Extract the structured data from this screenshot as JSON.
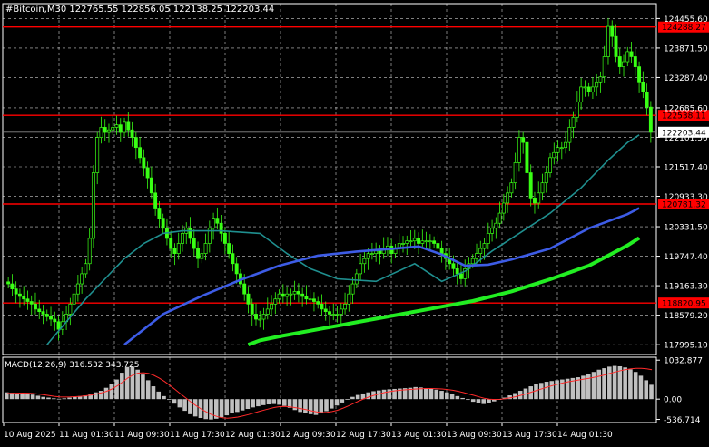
{
  "header": {
    "symbol": "#Bitcoin,M30",
    "ohlc": "122765.55 122856.05 122138.25 122203.44"
  },
  "macd": {
    "label": "MACD(12,26,9) 316.532 343.725",
    "ticks": [
      {
        "label": "1032.877",
        "v": 1032.877
      },
      {
        "label": "0.00",
        "v": 0
      },
      {
        "label": "-536.714",
        "v": -536.714
      }
    ],
    "range": [
      -620,
      1110
    ],
    "histogram": [
      180,
      170,
      160,
      150,
      140,
      120,
      90,
      60,
      40,
      20,
      10,
      20,
      40,
      60,
      80,
      100,
      140,
      180,
      220,
      300,
      400,
      520,
      700,
      850,
      860,
      780,
      650,
      500,
      340,
      200,
      80,
      -20,
      -120,
      -220,
      -310,
      -400,
      -460,
      -500,
      -530,
      -540,
      -520,
      -480,
      -430,
      -380,
      -340,
      -300,
      -260,
      -220,
      -190,
      -160,
      -140,
      -130,
      -150,
      -180,
      -230,
      -290,
      -340,
      -370,
      -400,
      -420,
      -380,
      -320,
      -250,
      -170,
      -90,
      -10,
      60,
      110,
      150,
      180,
      210,
      230,
      250,
      260,
      270,
      280,
      290,
      300,
      320,
      310,
      290,
      270,
      250,
      220,
      180,
      130,
      80,
      30,
      -20,
      -70,
      -110,
      -130,
      -100,
      -60,
      -10,
      40,
      100,
      160,
      220,
      280,
      340,
      400,
      430,
      460,
      480,
      500,
      520,
      540,
      560,
      580,
      620,
      660,
      720,
      780,
      820,
      860,
      880,
      870,
      840,
      790,
      720,
      620,
      500,
      380
    ],
    "signal": [
      150,
      155,
      158,
      160,
      158,
      150,
      135,
      115,
      95,
      75,
      60,
      55,
      58,
      65,
      75,
      90,
      110,
      135,
      165,
      210,
      270,
      350,
      450,
      560,
      640,
      690,
      700,
      680,
      630,
      560,
      470,
      370,
      260,
      150,
      40,
      -70,
      -170,
      -260,
      -340,
      -410,
      -460,
      -495,
      -505,
      -495,
      -475,
      -445,
      -410,
      -370,
      -330,
      -290,
      -255,
      -220,
      -200,
      -195,
      -205,
      -225,
      -250,
      -280,
      -310,
      -340,
      -355,
      -350,
      -330,
      -295,
      -245,
      -185,
      -120,
      -55,
      5,
      55,
      100,
      140,
      175,
      200,
      220,
      235,
      248,
      258,
      268,
      276,
      280,
      280,
      276,
      268,
      255,
      235,
      208,
      175,
      138,
      100,
      60,
      25,
      0,
      -10,
      -5,
      10,
      35,
      65,
      100,
      140,
      185,
      230,
      275,
      318,
      358,
      395,
      428,
      458,
      484,
      508,
      530,
      552,
      578,
      608,
      642,
      680,
      718,
      754,
      784,
      806,
      818,
      818,
      806,
      782
    ]
  },
  "chart_data": {
    "type": "candlestick",
    "series_name": "#Bitcoin,M30",
    "ylim": [
      117800,
      124750
    ],
    "y_ticks": [
      124455.6,
      123871.5,
      123287.4,
      122685.6,
      122101.5,
      121517.4,
      120933.3,
      120331.5,
      119747.4,
      119163.3,
      118579.2,
      117995.1
    ],
    "x_ticks": [
      "10 Aug 2025",
      "11 Aug 01:30",
      "11 Aug 09:30",
      "11 Aug 17:30",
      "12 Aug 01:30",
      "12 Aug 09:30",
      "12 Aug 17:30",
      "13 Aug 01:30",
      "13 Aug 09:30",
      "13 Aug 17:30",
      "14 Aug 01:30"
    ],
    "level_lines": [
      {
        "label": "124288.27",
        "value": 124288.27,
        "color": "#ff0000"
      },
      {
        "label": "122538.11",
        "value": 122538.11,
        "color": "#ff0000"
      },
      {
        "label": "120781.32",
        "value": 120781.32,
        "color": "#ff0000"
      },
      {
        "label": "118820.95",
        "value": 118820.95,
        "color": "#ff0000"
      }
    ],
    "current_price": {
      "label": "122203.44",
      "value": 122203.44
    },
    "close": [
      119200,
      119100,
      119000,
      118950,
      118900,
      118850,
      118800,
      118700,
      118650,
      118600,
      118550,
      118500,
      118450,
      118300,
      118450,
      118600,
      118800,
      119000,
      119200,
      119400,
      119600,
      120100,
      121400,
      122100,
      122300,
      122200,
      122250,
      122300,
      122350,
      122200,
      122400,
      122250,
      122100,
      121900,
      121700,
      121500,
      121300,
      121000,
      120700,
      120500,
      120300,
      120100,
      119900,
      119800,
      120000,
      120200,
      120300,
      120100,
      119900,
      119700,
      119800,
      120000,
      120300,
      120500,
      120400,
      120200,
      120000,
      119800,
      119600,
      119400,
      119200,
      119000,
      118800,
      118600,
      118500,
      118500,
      118600,
      118700,
      118800,
      118900,
      119000,
      118950,
      119000,
      119000,
      119050,
      119000,
      118950,
      118900,
      118900,
      118850,
      118800,
      118700,
      118650,
      118600,
      118600,
      118600,
      118700,
      118800,
      119000,
      119200,
      119400,
      119600,
      119700,
      119800,
      119800,
      119850,
      119800,
      119900,
      119950,
      119800,
      119900,
      120000,
      120000,
      120050,
      120050,
      120100,
      120000,
      120050,
      120050,
      120050,
      120000,
      119900,
      119800,
      119700,
      119600,
      119500,
      119400,
      119300,
      119500,
      119600,
      119700,
      119800,
      119900,
      120000,
      120200,
      120300,
      120400,
      120600,
      120800,
      121000,
      121200,
      121600,
      122100,
      122000,
      121400,
      120900,
      120800,
      121000,
      121200,
      121400,
      121700,
      121800,
      121900,
      121900,
      122000,
      122300,
      122500,
      122800,
      123100,
      123100,
      123000,
      123100,
      123200,
      123300,
      123700,
      124300,
      124100,
      123700,
      123500,
      123600,
      123800,
      123700,
      123500,
      123200,
      123000,
      122700,
      122203
    ],
    "wicks": 150,
    "ma_slow": {
      "color": "#22ee22",
      "points": [
        [
          62,
          117995
        ],
        [
          65,
          118080
        ],
        [
          70,
          118160
        ],
        [
          80,
          118300
        ],
        [
          90,
          118440
        ],
        [
          100,
          118580
        ],
        [
          110,
          118720
        ],
        [
          120,
          118860
        ],
        [
          130,
          119050
        ],
        [
          140,
          119290
        ],
        [
          150,
          119560
        ],
        [
          155,
          119760
        ],
        [
          160,
          119960
        ],
        [
          163,
          120110
        ]
      ]
    },
    "ma_mid": {
      "color": "#3d5ce6",
      "points": [
        [
          30,
          117995
        ],
        [
          35,
          118300
        ],
        [
          40,
          118600
        ],
        [
          50,
          118960
        ],
        [
          60,
          119280
        ],
        [
          70,
          119560
        ],
        [
          80,
          119760
        ],
        [
          90,
          119840
        ],
        [
          100,
          119900
        ],
        [
          106,
          119940
        ],
        [
          112,
          119780
        ],
        [
          118,
          119560
        ],
        [
          124,
          119580
        ],
        [
          130,
          119680
        ],
        [
          140,
          119900
        ],
        [
          150,
          120300
        ],
        [
          160,
          120580
        ],
        [
          163,
          120700
        ]
      ]
    },
    "ma_fast": {
      "color": "#1f8f8f",
      "points": [
        [
          10,
          117995
        ],
        [
          15,
          118450
        ],
        [
          20,
          118900
        ],
        [
          25,
          119300
        ],
        [
          30,
          119700
        ],
        [
          35,
          120000
        ],
        [
          40,
          120200
        ],
        [
          45,
          120250
        ],
        [
          55,
          120250
        ],
        [
          65,
          120200
        ],
        [
          72,
          119800
        ],
        [
          78,
          119500
        ],
        [
          85,
          119300
        ],
        [
          95,
          119250
        ],
        [
          105,
          119600
        ],
        [
          112,
          119250
        ],
        [
          118,
          119450
        ],
        [
          125,
          119850
        ],
        [
          132,
          120200
        ],
        [
          140,
          120600
        ],
        [
          148,
          121100
        ],
        [
          155,
          121650
        ],
        [
          160,
          122000
        ],
        [
          163,
          122150
        ]
      ]
    }
  }
}
